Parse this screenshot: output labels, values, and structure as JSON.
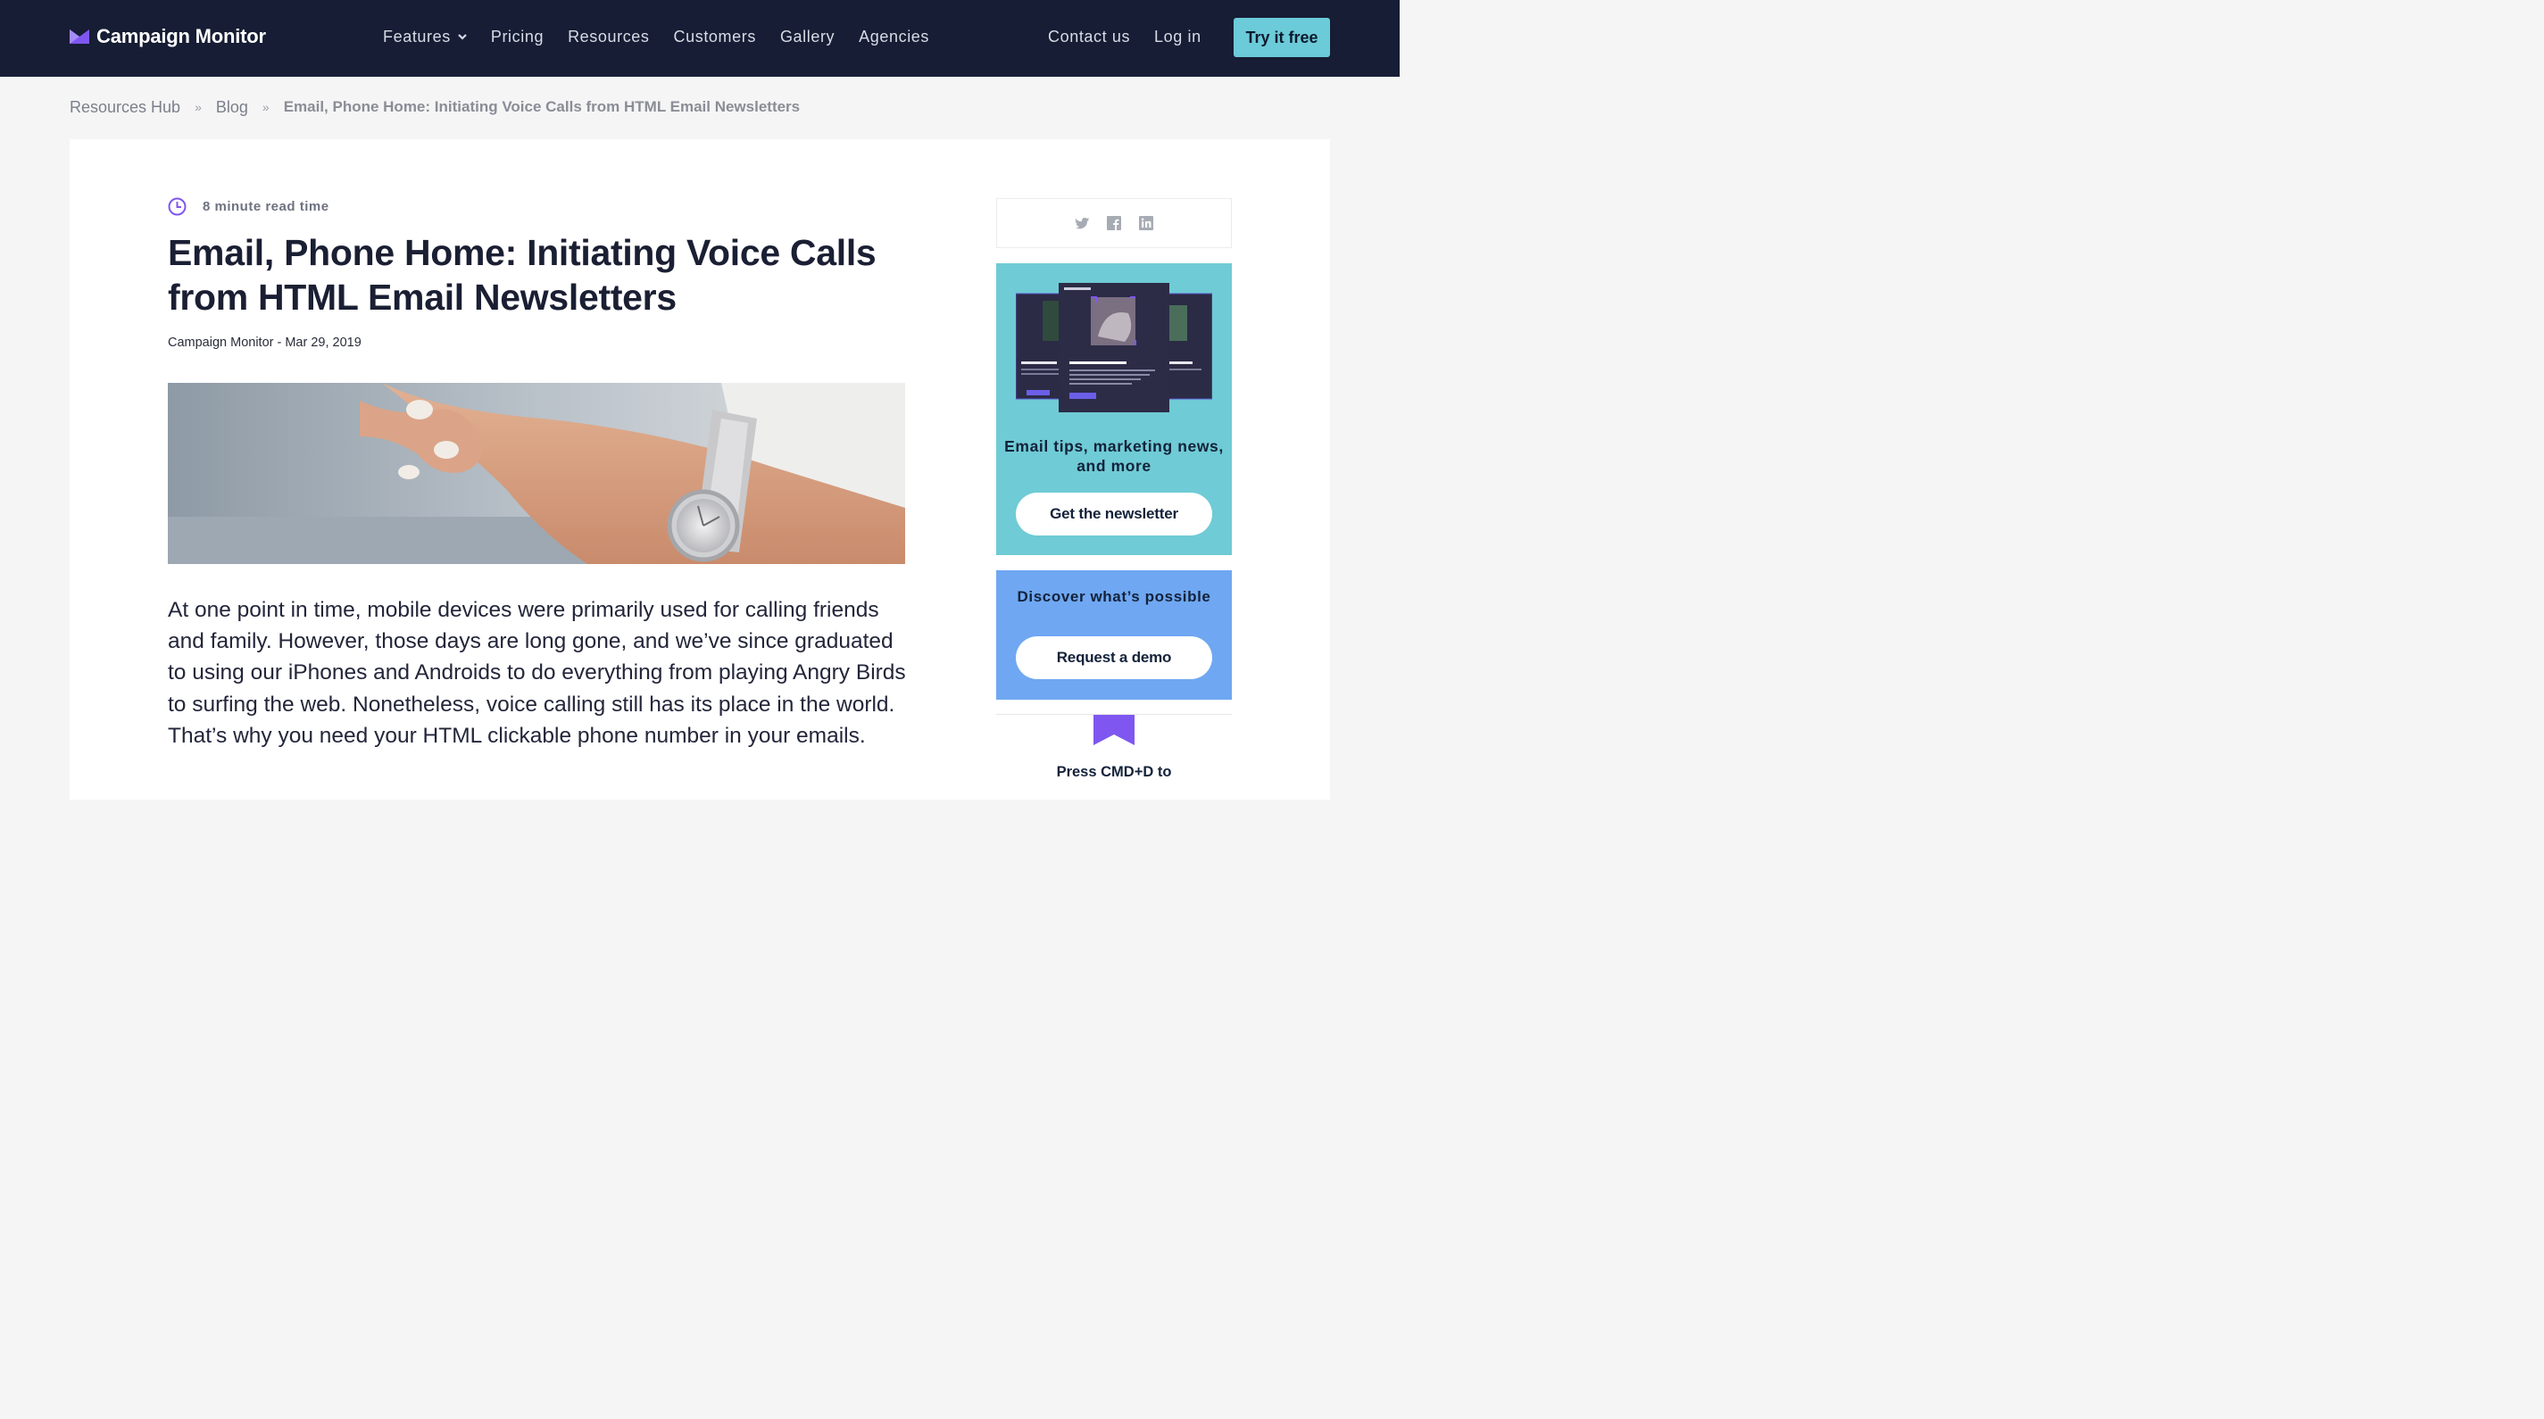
{
  "header": {
    "logo_text": "Campaign Monitor",
    "nav": {
      "features": "Features",
      "pricing": "Pricing",
      "resources": "Resources",
      "customers": "Customers",
      "gallery": "Gallery",
      "agencies": "Agencies"
    },
    "contact": "Contact us",
    "login": "Log in",
    "try_free": "Try it free"
  },
  "breadcrumb": {
    "hub": "Resources Hub",
    "blog": "Blog",
    "separator": "»",
    "current": "Email, Phone Home: Initiating Voice Calls from HTML Email Newsletters"
  },
  "article": {
    "read_time": "8 minute read time",
    "title": "Email, Phone Home: Initiating Voice Calls from HTML Email Newsletters",
    "byline": "Campaign Monitor - Mar 29, 2019",
    "intro": "At one point in time, mobile devices were primarily used for calling friends and family. However, those days are long gone, and we’ve since graduated to using our iPhones and Androids to do everything from playing Angry Birds to surfing the web. Nonetheless, voice calling still has its place in the world. That’s why you need your HTML clickable phone number in your emails."
  },
  "sidebar": {
    "share_icons": [
      "twitter-icon",
      "facebook-icon",
      "linkedin-icon"
    ],
    "newsletter": {
      "text": "Email tips, marketing news, and more",
      "button": "Get the newsletter"
    },
    "demo": {
      "text": "Discover what’s possible",
      "button": "Request a demo"
    },
    "bookmark_text": "Press CMD+D to"
  },
  "colors": {
    "header_bg": "#161d34",
    "accent_teal": "#6ccbd8",
    "newsletter_bg": "#6fcbd5",
    "demo_bg": "#6fa7f2",
    "brand_purple": "#7f57f0"
  }
}
